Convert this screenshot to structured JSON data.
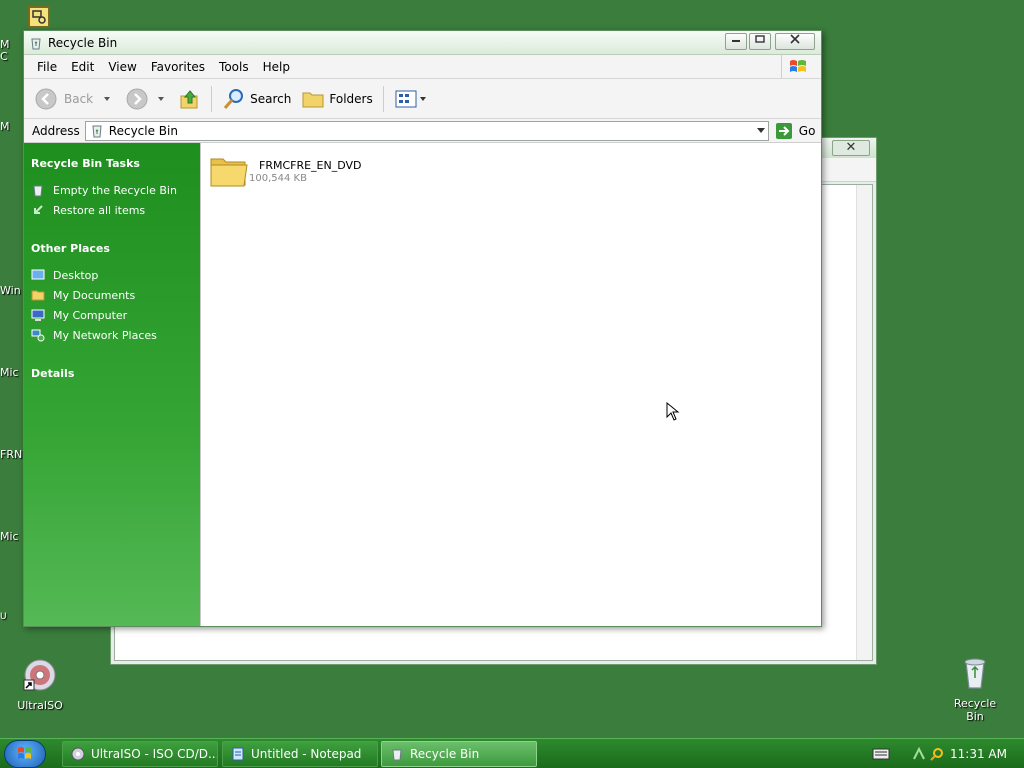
{
  "desktop": {
    "left_clipped_labels": [
      "M",
      "C",
      "M",
      "Win",
      "Mic",
      "FRN",
      "Mic",
      "U"
    ],
    "icons": {
      "ultraiso": {
        "label": "UltraISO"
      },
      "recycle_bin": {
        "label": "Recycle Bin"
      }
    }
  },
  "window": {
    "title": "Recycle Bin",
    "menu": [
      "File",
      "Edit",
      "View",
      "Favorites",
      "Tools",
      "Help"
    ],
    "toolbar": {
      "back_label": "Back",
      "search_label": "Search",
      "folders_label": "Folders"
    },
    "address": {
      "label": "Address",
      "value": "Recycle Bin",
      "go_label": "Go"
    },
    "sidebar": {
      "tasks_title": "Recycle Bin Tasks",
      "tasks": [
        "Empty the Recycle Bin",
        "Restore all items"
      ],
      "places_title": "Other Places",
      "places": [
        "Desktop",
        "My Documents",
        "My Computer",
        "My Network Places"
      ],
      "details_title": "Details"
    },
    "files": [
      {
        "name": "FRMCFRE_EN_DVD",
        "size": "100,544 KB"
      }
    ]
  },
  "back_window": {
    "close_glyph": "✕"
  },
  "taskbar": {
    "tasks": [
      {
        "label": "UltraISO - ISO CD/D..."
      },
      {
        "label": "Untitled - Notepad"
      },
      {
        "label": "Recycle Bin"
      }
    ],
    "clock": "11:31 AM"
  },
  "colors": {
    "desktop": "#3a7d3c",
    "sidebar": "#1e8f1e",
    "taskbar": "#1b6b1b"
  }
}
